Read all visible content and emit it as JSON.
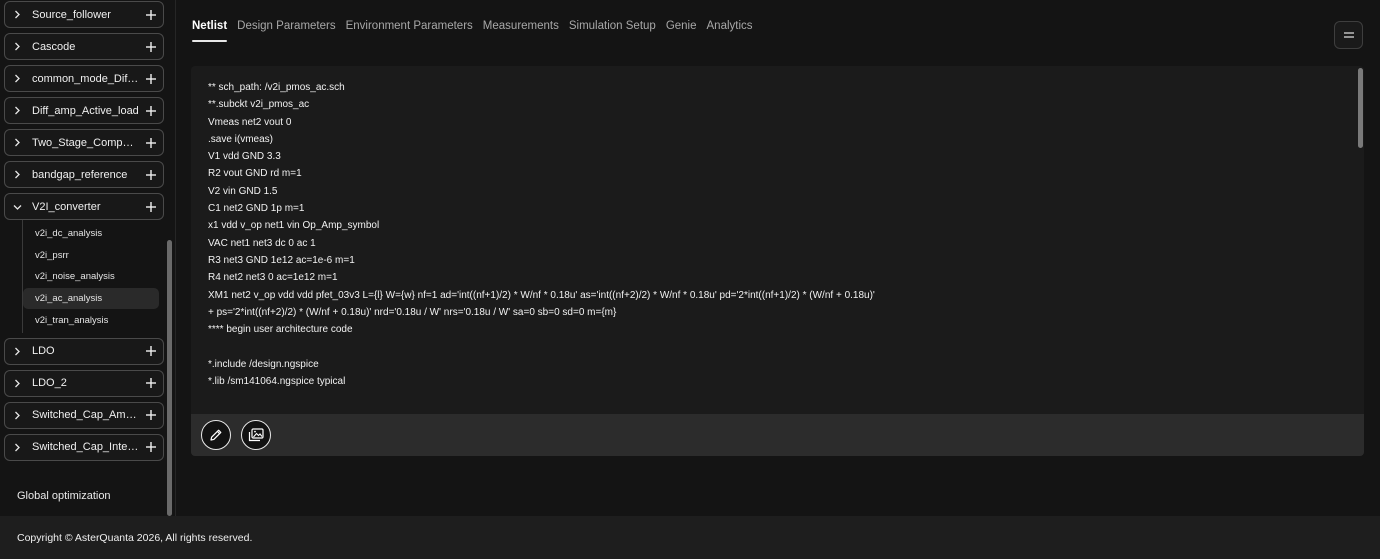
{
  "sidebar": {
    "projects_top": [
      {
        "name": "Source_follower"
      },
      {
        "name": "Cascode"
      },
      {
        "name": "common_mode_Diffa..."
      },
      {
        "name": "Diff_amp_Active_load"
      },
      {
        "name": "Two_Stage_Compara..."
      },
      {
        "name": "bandgap_reference"
      },
      {
        "name": "V2I_converter"
      }
    ],
    "expanded_items": [
      {
        "label": "v2i_dc_analysis"
      },
      {
        "label": "v2i_psrr"
      },
      {
        "label": "v2i_noise_analysis"
      },
      {
        "label": "v2i_ac_analysis"
      },
      {
        "label": "v2i_tran_analysis"
      }
    ],
    "projects_bottom": [
      {
        "name": "LDO"
      },
      {
        "name": "LDO_2"
      },
      {
        "name": "Switched_Cap_Ampli..."
      },
      {
        "name": "Switched_Cap_Integr..."
      }
    ],
    "global_optimization": "Global optimization"
  },
  "tabs": [
    {
      "label": "Netlist"
    },
    {
      "label": "Design Parameters"
    },
    {
      "label": "Environment Parameters"
    },
    {
      "label": "Measurements"
    },
    {
      "label": "Simulation Setup"
    },
    {
      "label": "Genie"
    },
    {
      "label": "Analytics"
    }
  ],
  "netlist_lines": [
    "** sch_path: /v2i_pmos_ac.sch",
    "**.subckt v2i_pmos_ac",
    "Vmeas net2 vout 0",
    ".save i(vmeas)",
    "V1 vdd GND 3.3",
    "R2 vout GND rd m=1",
    "V2 vin GND 1.5",
    "C1 net2 GND 1p m=1",
    "x1 vdd v_op net1 vin Op_Amp_symbol",
    "VAC net1 net3 dc 0 ac 1",
    "R3 net3 GND 1e12 ac=1e-6 m=1",
    "R4 net2 net3 0 ac=1e12 m=1",
    "XM1 net2 v_op vdd vdd pfet_03v3 L={l} W={w} nf=1 ad='int((nf+1)/2) * W/nf * 0.18u' as='int((nf+2)/2) * W/nf * 0.18u' pd='2*int((nf+1)/2) * (W/nf + 0.18u)'",
    "+ ps='2*int((nf+2)/2) * (W/nf + 0.18u)' nrd='0.18u / W' nrs='0.18u / W' sa=0 sb=0 sd=0 m={m}",
    "**** begin user architecture code",
    "",
    "*.include /design.ngspice",
    "*.lib /sm141064.ngspice typical"
  ],
  "footer": {
    "copyright": "Copyright © AsterQuanta 2026, All rights reserved."
  }
}
